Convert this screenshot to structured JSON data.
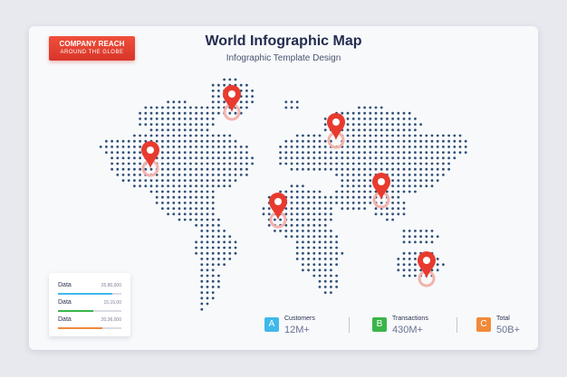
{
  "badge": {
    "line1": "COMPANY REACH",
    "line2": "AROUND THE GLOBE"
  },
  "header": {
    "title": "World Infographic Map",
    "subtitle": "Infographic Template Design"
  },
  "legend": {
    "rows": [
      {
        "label": "Data",
        "value": "25,80,000",
        "fill": 0.85,
        "color": "#3fb8ea"
      },
      {
        "label": "Data",
        "value": "15,15,00",
        "fill": 0.55,
        "color": "#3ab54a"
      },
      {
        "label": "Data",
        "value": "20,36,000",
        "fill": 0.7,
        "color": "#f08a3a"
      }
    ]
  },
  "stats": [
    {
      "letter": "A",
      "label": "Customers",
      "value": "12M+",
      "color": "#3fb8ea"
    },
    {
      "letter": "B",
      "label": "Transactions",
      "value": "430M+",
      "color": "#3ab54a"
    },
    {
      "letter": "C",
      "label": "Total",
      "value": "50B+",
      "color": "#f08a3a"
    }
  ],
  "map": {
    "dot_color": "#2f4f77",
    "pin_color": "#e83a2e",
    "pins": [
      "North America",
      "Greenland",
      "Europe",
      "Africa",
      "South Asia",
      "Australia"
    ]
  }
}
